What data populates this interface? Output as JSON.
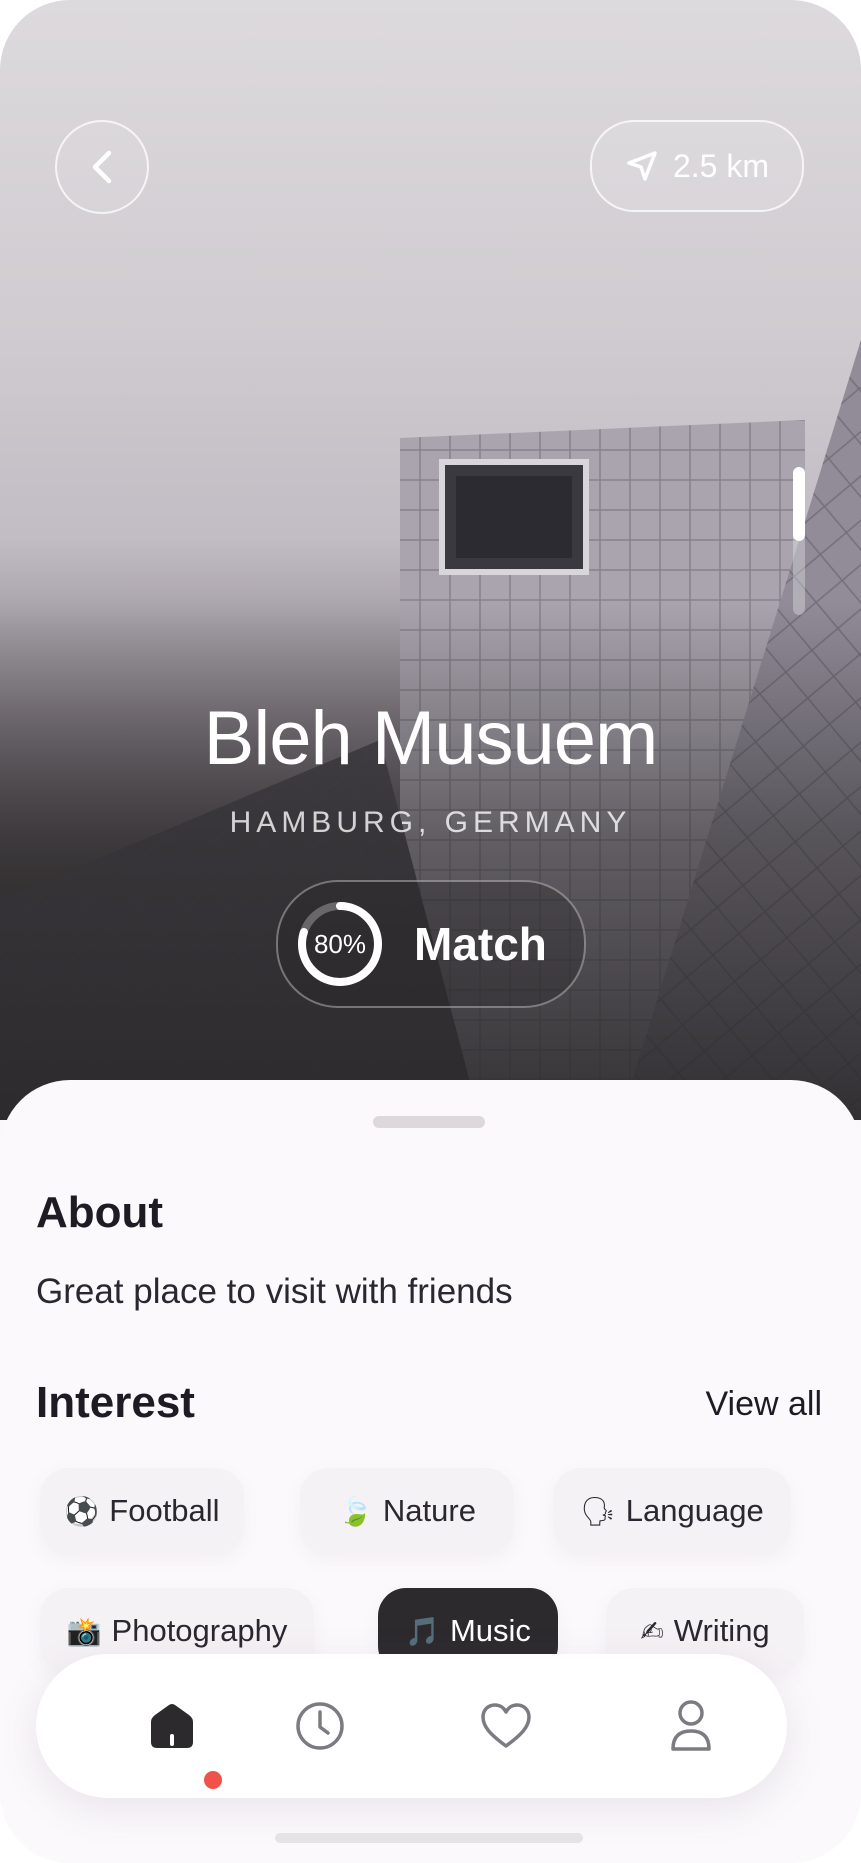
{
  "place": {
    "title": "Bleh Musuem",
    "location": "HAMBURG, GERMANY",
    "distance": "2.5 km",
    "match_percent_label": "80%",
    "match_fraction": 0.8,
    "match_label": "Match"
  },
  "about": {
    "heading": "About",
    "text": "Great place to visit with friends"
  },
  "interest": {
    "heading": "Interest",
    "view_all": "View all",
    "chips": [
      {
        "emoji": "⚽",
        "label": "Football",
        "active": false
      },
      {
        "emoji": "🍃",
        "label": "Nature",
        "active": false
      },
      {
        "emoji": "🗣",
        "label": "Language",
        "active": false
      },
      {
        "emoji": "📸",
        "label": "Photography",
        "active": false
      },
      {
        "emoji": "🎵",
        "label": "Music",
        "active": true
      },
      {
        "emoji": "✍",
        "label": "Writing",
        "active": false
      }
    ]
  },
  "nav": {
    "items": [
      {
        "icon": "home-icon",
        "active": true
      },
      {
        "icon": "clock-icon",
        "active": false
      },
      {
        "icon": "heart-icon",
        "active": false
      },
      {
        "icon": "user-icon",
        "active": false
      }
    ],
    "active_dot_color": "#f0524a"
  },
  "colors": {
    "accent_dark": "#2c2a2d",
    "text_primary": "#1f1b24"
  }
}
